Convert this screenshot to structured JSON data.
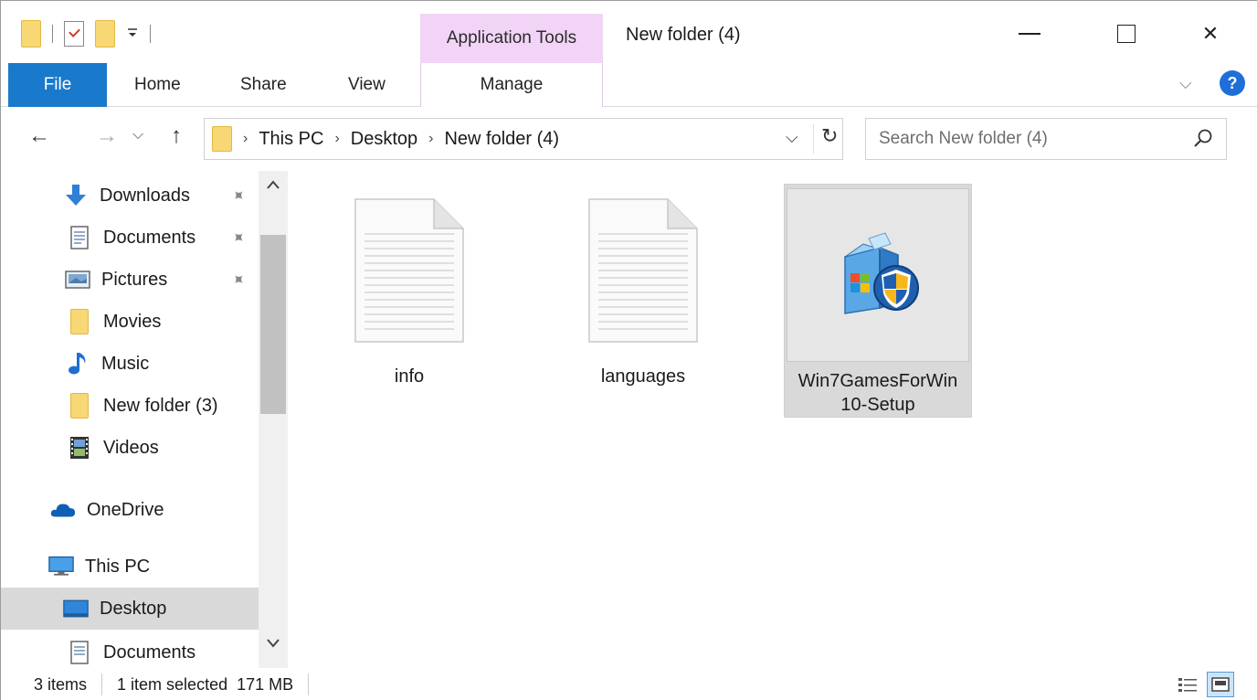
{
  "window": {
    "title": "New folder (4)",
    "context_tab": "Application Tools",
    "min_glyph": "",
    "close_glyph": "✕"
  },
  "ribbon": {
    "tabs": [
      {
        "label": "File"
      },
      {
        "label": "Home"
      },
      {
        "label": "Share"
      },
      {
        "label": "View"
      },
      {
        "label": "Manage"
      }
    ],
    "collapse_glyph": "⌵",
    "help_label": "?"
  },
  "nav": {
    "back_glyph": "←",
    "forward_glyph": "→",
    "recent_glyph": "⌵",
    "up_glyph": "↑"
  },
  "address": {
    "crumbs": [
      "This PC",
      "Desktop",
      "New folder (4)"
    ],
    "sep_glyph": "›",
    "dropdown_glyph": "⌵",
    "refresh_glyph": "↻"
  },
  "search": {
    "placeholder": "Search New folder (4)"
  },
  "navpane": {
    "items": [
      {
        "label": "Downloads",
        "icon": "download-icon",
        "pinned": true
      },
      {
        "label": "Documents",
        "icon": "document-icon",
        "pinned": true
      },
      {
        "label": "Pictures",
        "icon": "picture-icon",
        "pinned": true
      },
      {
        "label": "Movies",
        "icon": "folder-icon",
        "pinned": false
      },
      {
        "label": "Music",
        "icon": "music-icon",
        "pinned": false
      },
      {
        "label": "New folder (3)",
        "icon": "folder-icon",
        "pinned": false
      },
      {
        "label": "Videos",
        "icon": "video-icon",
        "pinned": false
      },
      {
        "label": "OneDrive",
        "icon": "onedrive-icon",
        "pinned": false
      },
      {
        "label": "This PC",
        "icon": "computer-icon",
        "pinned": false
      },
      {
        "label": "Desktop",
        "icon": "desktop-icon",
        "pinned": false
      },
      {
        "label": "Documents",
        "icon": "document-icon",
        "pinned": false
      }
    ],
    "pin_glyph": "📌",
    "scroll_up_glyph": "⌃",
    "scroll_down_glyph": "⌄"
  },
  "files": [
    {
      "name": "info",
      "type": "text-file-icon",
      "selected": false
    },
    {
      "name": "languages",
      "type": "text-file-icon",
      "selected": false
    },
    {
      "name": "Win7GamesForWin10-Setup",
      "type": "installer-icon",
      "selected": true
    }
  ],
  "status": {
    "count": "3 items",
    "selection": "1 item selected",
    "size": "171 MB"
  },
  "colors": {
    "file_tab": "#1979ca",
    "context_tab": "#f2d4f7",
    "selection": "#d9d9d9",
    "folder": "#f8d775"
  }
}
